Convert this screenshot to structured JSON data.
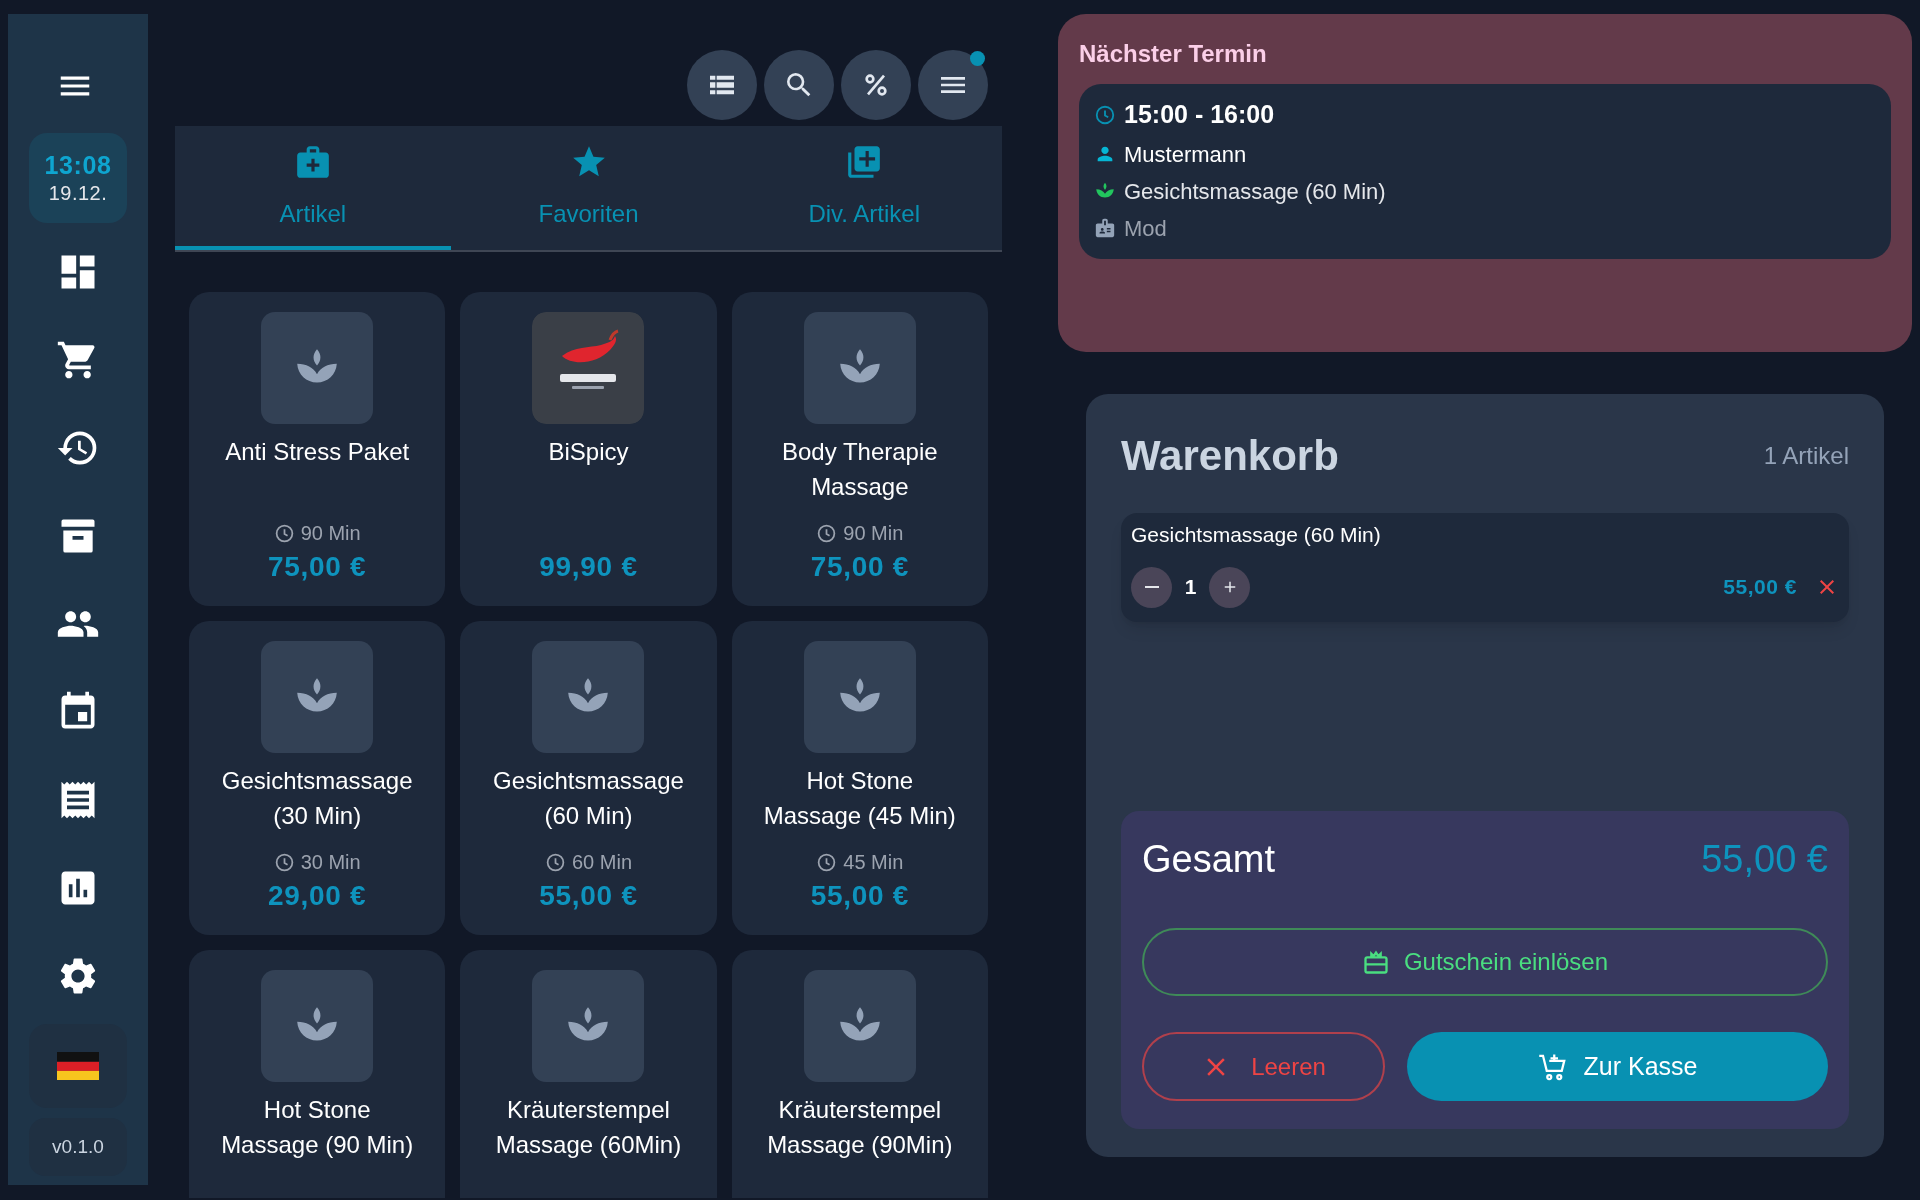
{
  "sidebar": {
    "clock": {
      "time": "13:08",
      "date": "19.12."
    },
    "version": "v0.1.0"
  },
  "toolbar": {
    "menu_has_notification": true
  },
  "tabs": [
    {
      "label": "Artikel",
      "selected": true
    },
    {
      "label": "Favoriten",
      "selected": false
    },
    {
      "label": "Div. Artikel",
      "selected": false
    }
  ],
  "products": [
    {
      "kind": "icon",
      "name": "Anti Stress Paket",
      "duration": "90 Min",
      "price": "75,00 €"
    },
    {
      "kind": "logo",
      "name": "BiSpicy",
      "price": "99,90 €"
    },
    {
      "kind": "icon",
      "name": "Body Therapie Massage",
      "duration": "90 Min",
      "price": "75,00 €"
    },
    {
      "kind": "icon",
      "name": "Gesichtsmassage (30 Min)",
      "duration": "30 Min",
      "price": "29,00 €"
    },
    {
      "kind": "icon",
      "name": "Gesichtsmassage (60 Min)",
      "duration": "60 Min",
      "price": "55,00 €"
    },
    {
      "kind": "icon",
      "name": "Hot Stone Massage (45 Min)",
      "duration": "45 Min",
      "price": "55,00 €"
    },
    {
      "kind": "icon",
      "name": "Hot Stone Massage (90 Min)"
    },
    {
      "kind": "icon",
      "name": "Kräuterstempel Massage (60Min)"
    },
    {
      "kind": "icon",
      "name": "Kräuterstempel Massage (90Min)"
    }
  ],
  "next_appointment": {
    "title": "Nächster Termin",
    "time": "15:00 - 16:00",
    "customer": "Mustermann",
    "service": "Gesichtsmassage (60 Min)",
    "staff": "Mod"
  },
  "cart": {
    "title": "Warenkorb",
    "count": "1 Artikel",
    "items": [
      {
        "name": "Gesichtsmassage (60 Min)",
        "quantity": "1",
        "price": "55,00 €"
      }
    ],
    "total_label": "Gesamt",
    "total": "55,00 €",
    "voucher_button": "Gutschein einlösen",
    "clear_button": "Leeren",
    "checkout_button": "Zur Kasse"
  }
}
